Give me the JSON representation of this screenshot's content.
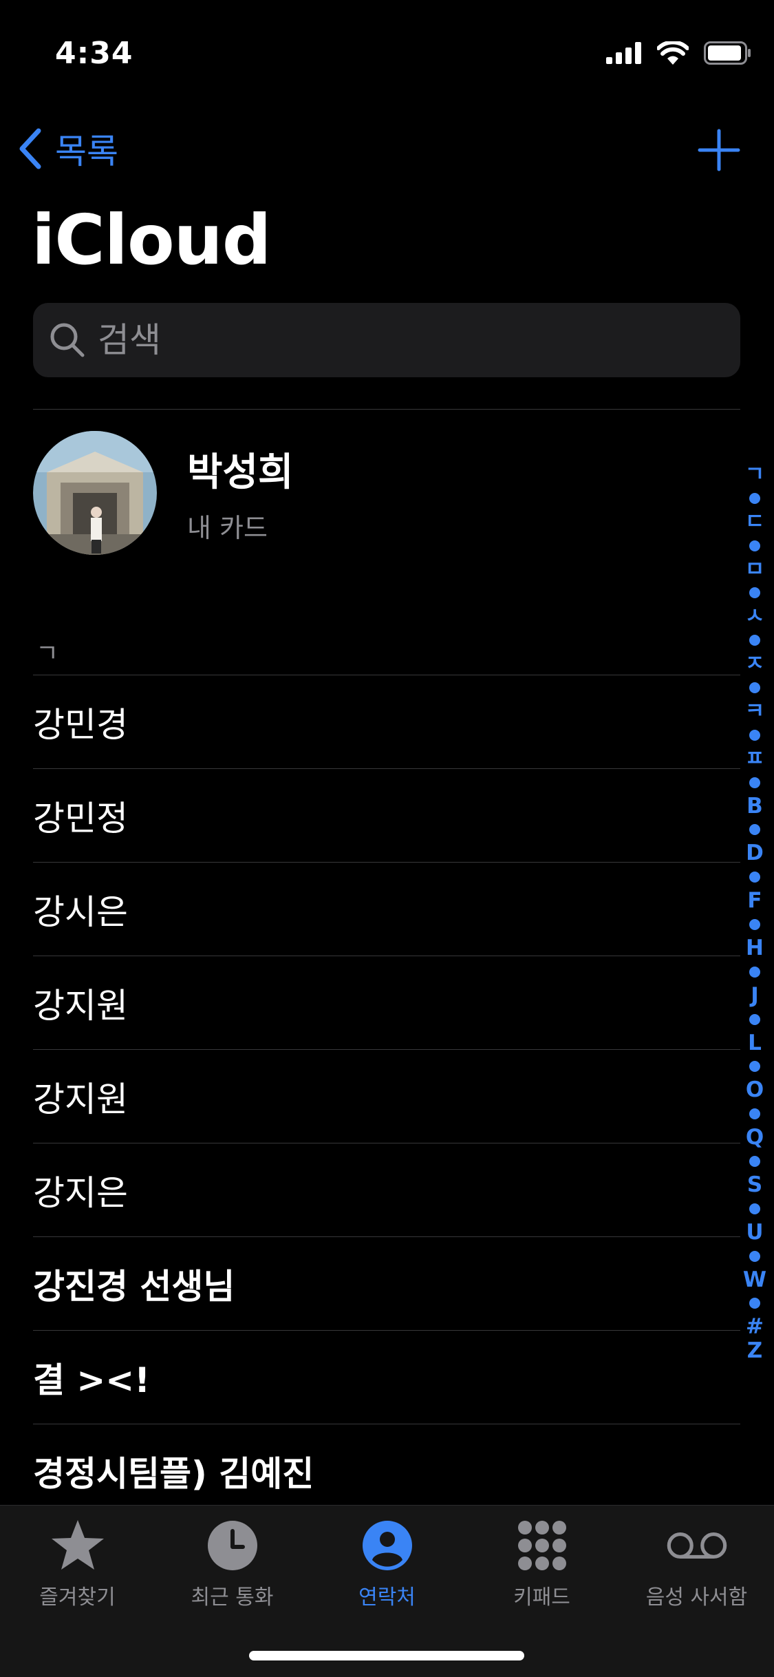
{
  "status": {
    "time": "4:34"
  },
  "nav": {
    "back_label": "목록"
  },
  "title": "iCloud",
  "search": {
    "placeholder": "검색"
  },
  "my_card": {
    "name": "박성희",
    "subtitle": "내 카드"
  },
  "section_header": "ㄱ",
  "contacts": [
    {
      "name": "강민경",
      "bold": false
    },
    {
      "name": "강민정",
      "bold": false
    },
    {
      "name": "강시은",
      "bold": false
    },
    {
      "name": "강지원",
      "bold": false
    },
    {
      "name": "강지원",
      "bold": false
    },
    {
      "name": "강지은",
      "bold": false
    },
    {
      "name": "강진경 선생님",
      "bold": true
    },
    {
      "name": "결 ><!",
      "bold": true
    },
    {
      "name": "경정시팀플) 김예진",
      "bold": true
    }
  ],
  "index": [
    "ㄱ",
    "•",
    "ㄷ",
    "•",
    "ㅁ",
    "•",
    "ㅅ",
    "•",
    "ㅈ",
    "•",
    "ㅋ",
    "•",
    "ㅍ",
    "•",
    "B",
    "•",
    "D",
    "•",
    "F",
    "•",
    "H",
    "•",
    "J",
    "•",
    "L",
    "•",
    "O",
    "•",
    "Q",
    "•",
    "S",
    "•",
    "U",
    "•",
    "W",
    "•",
    "#",
    "Z"
  ],
  "tabs": [
    {
      "label": "즐겨찾기",
      "icon": "star-icon",
      "active": false
    },
    {
      "label": "최근 통화",
      "icon": "clock-icon",
      "active": false
    },
    {
      "label": "연락처",
      "icon": "person-icon",
      "active": true
    },
    {
      "label": "키패드",
      "icon": "keypad-icon",
      "active": false
    },
    {
      "label": "음성 사서함",
      "icon": "voicemail-icon",
      "active": false
    }
  ],
  "colors": {
    "accent": "#3a84f5",
    "background": "#000000",
    "secondary_text": "#8e8e93"
  }
}
